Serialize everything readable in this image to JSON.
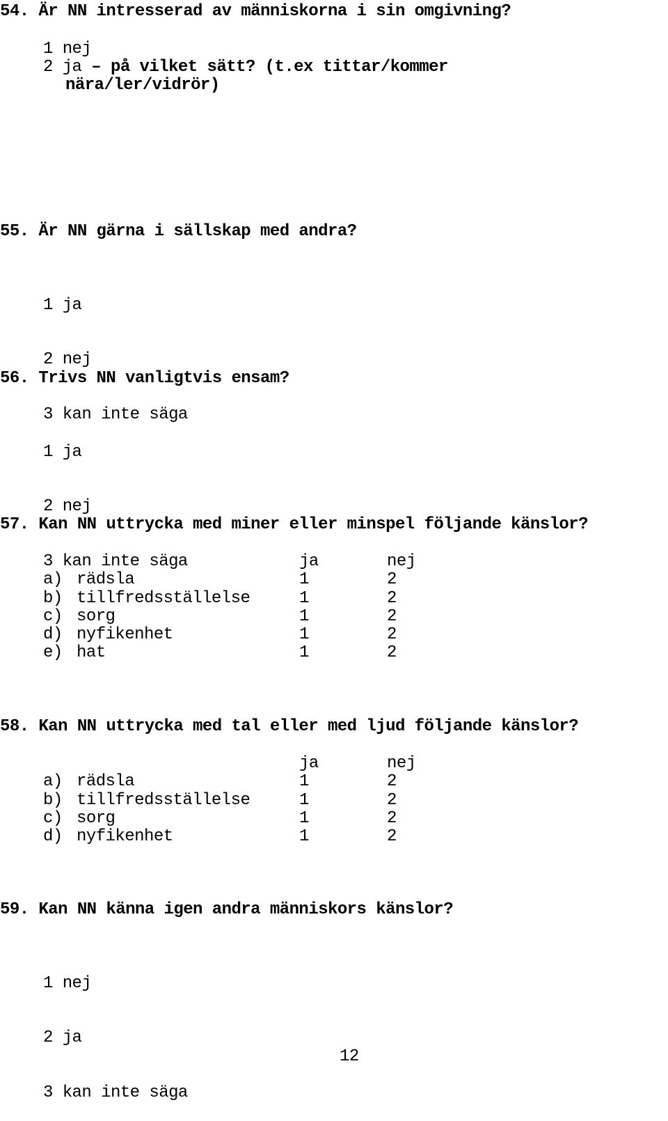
{
  "questions": {
    "q54": {
      "title": "54. Är NN intresserad av människorna i sin omgivning?",
      "opt1": "1 nej",
      "opt2_prefix": "2 ja ",
      "opt2_bold": "– på vilket sätt? (t.ex tittar/kommer",
      "opt2_cont": "nära/ler/vidrör)"
    },
    "q55": {
      "title": "55. Är NN gärna i sällskap med andra?",
      "options": [
        "1 ja",
        "2 nej",
        "3 kan inte säga"
      ]
    },
    "q56": {
      "title": "56. Trivs NN vanligtvis ensam?",
      "options": [
        "1 ja",
        "2 nej",
        "3 kan inte säga"
      ]
    },
    "q57": {
      "title": "57. Kan NN uttrycka med miner eller minspel följande känslor?",
      "col_ja": "ja",
      "col_nej": "nej",
      "rows": [
        {
          "label": "a)",
          "name": "rädsla",
          "ja": "1",
          "nej": "2"
        },
        {
          "label": "b)",
          "name": "tillfredsställelse",
          "ja": "1",
          "nej": "2"
        },
        {
          "label": "c)",
          "name": "sorg",
          "ja": "1",
          "nej": "2"
        },
        {
          "label": "d)",
          "name": "nyfikenhet",
          "ja": "1",
          "nej": "2"
        },
        {
          "label": "e)",
          "name": "hat",
          "ja": "1",
          "nej": "2"
        }
      ]
    },
    "q58": {
      "title": "58. Kan NN uttrycka med tal eller med ljud följande känslor?",
      "col_ja": "ja",
      "col_nej": "nej",
      "rows": [
        {
          "label": "a)",
          "name": "rädsla",
          "ja": "1",
          "nej": "2"
        },
        {
          "label": "b)",
          "name": "tillfredsställelse",
          "ja": "1",
          "nej": "2"
        },
        {
          "label": "c)",
          "name": "sorg",
          "ja": "1",
          "nej": "2"
        },
        {
          "label": "d)",
          "name": "nyfikenhet",
          "ja": "1",
          "nej": "2"
        }
      ]
    },
    "q59": {
      "title": "59. Kan NN känna igen andra människors känslor?",
      "options": [
        "1 nej",
        "2 ja",
        "3 kan inte säga"
      ]
    }
  },
  "page_number": "12"
}
